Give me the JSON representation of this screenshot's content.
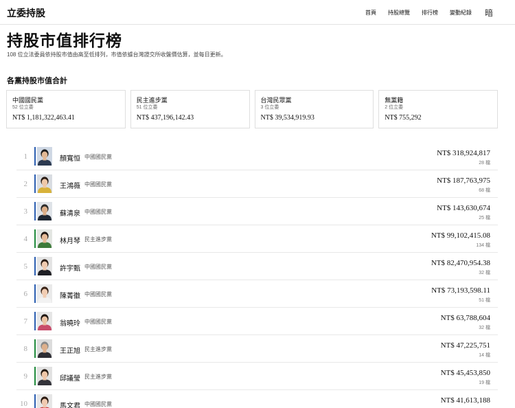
{
  "header": {
    "brand": "立委持股",
    "nav": [
      "首頁",
      "持股總覽",
      "排行榜",
      "變動紀錄"
    ],
    "theme_toggle": "暗"
  },
  "page": {
    "title": "持股市值排行榜",
    "subtitle": "108 位立法委員依持股市值由高至低排列，市值依據台灣證交所收盤價估算，並每日更新。"
  },
  "party_section": {
    "title": "各黨持股市值合計",
    "cards": [
      {
        "name": "中國國民黨",
        "count": "52 位立委",
        "value": "NT$ 1,181,322,463.41"
      },
      {
        "name": "民主進步黨",
        "count": "51 位立委",
        "value": "NT$ 437,196,142.43"
      },
      {
        "name": "台灣民眾黨",
        "count": "3 位立委",
        "value": "NT$ 39,534,919.93"
      },
      {
        "name": "無黨籍",
        "count": "2 位立委",
        "value": "NT$ 755,292"
      }
    ]
  },
  "party_colors": {
    "中國國民黨": "#2a5db0",
    "民主進步黨": "#1f8a3b",
    "台灣民眾黨": "#28a8a8",
    "無黨籍": "#999999"
  },
  "ranking": [
    {
      "rank": "1",
      "name": "顏寬恒",
      "party": "中國國民黨",
      "value": "NT$ 318,924,817",
      "stocks": "28 檔",
      "bg": "#cfd8e4",
      "face": "#e2b995",
      "hair": "#1c1c1c",
      "shirt": "#2c3a50"
    },
    {
      "rank": "2",
      "name": "王鴻薇",
      "party": "中國國民黨",
      "value": "NT$ 187,763,975",
      "stocks": "68 檔",
      "bg": "#d9dde2",
      "face": "#efc8a8",
      "hair": "#2a1d16",
      "shirt": "#d8b23a"
    },
    {
      "rank": "3",
      "name": "蘇清泉",
      "party": "中國國民黨",
      "value": "NT$ 143,630,674",
      "stocks": "25 檔",
      "bg": "#dfe3e8",
      "face": "#dcae88",
      "hair": "#2b2b2b",
      "shirt": "#1f2733"
    },
    {
      "rank": "4",
      "name": "林月琴",
      "party": "民主進步黨",
      "value": "NT$ 99,102,415.08",
      "stocks": "134 檔",
      "bg": "#e3e6e2",
      "face": "#e6bb98",
      "hair": "#1d1612",
      "shirt": "#3d7a3a"
    },
    {
      "rank": "5",
      "name": "許宇甄",
      "party": "中國國民黨",
      "value": "NT$ 82,470,954.38",
      "stocks": "32 檔",
      "bg": "#e4e4e4",
      "face": "#f0cbb0",
      "hair": "#2a1c14",
      "shirt": "#1e1e24"
    },
    {
      "rank": "6",
      "name": "陳菁徽",
      "party": "中國國民黨",
      "value": "NT$ 73,193,598.11",
      "stocks": "51 檔",
      "bg": "#eaeaea",
      "face": "#f1cdb3",
      "hair": "#3a2418",
      "shirt": "#f2f2f2"
    },
    {
      "rank": "7",
      "name": "翁曉玲",
      "party": "中國國民黨",
      "value": "NT$ 63,788,604",
      "stocks": "32 檔",
      "bg": "#e6e6e6",
      "face": "#ebc3a3",
      "hair": "#1f1712",
      "shirt": "#c84b6a"
    },
    {
      "rank": "8",
      "name": "王正旭",
      "party": "民主進步黨",
      "value": "NT$ 47,225,751",
      "stocks": "14 檔",
      "bg": "#dcdcdc",
      "face": "#deb08c",
      "hair": "#8a8a8a",
      "shirt": "#2d2d33"
    },
    {
      "rank": "9",
      "name": "邱議瑩",
      "party": "民主進步黨",
      "value": "NT$ 45,453,850",
      "stocks": "19 檔",
      "bg": "#e2e2e2",
      "face": "#efc7a9",
      "hair": "#231912",
      "shirt": "#33333a"
    },
    {
      "rank": "10",
      "name": "馬文君",
      "party": "中國國民黨",
      "value": "NT$ 41,613,188",
      "stocks": "",
      "bg": "#e6e6e6",
      "face": "#f0cab0",
      "hair": "#2b1b12",
      "shirt": "#cc3b3b"
    }
  ]
}
